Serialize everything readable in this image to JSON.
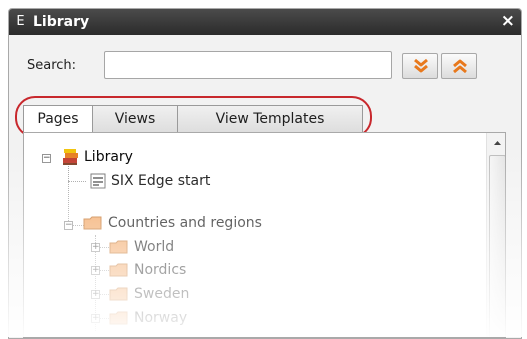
{
  "window": {
    "badge": "E",
    "title": "Library",
    "close_glyph": "×"
  },
  "search": {
    "label": "Search:",
    "value": "",
    "placeholder": ""
  },
  "nav": {
    "down_icon": "double-chevron-down-icon",
    "up_icon": "double-chevron-up-icon"
  },
  "tabs": [
    {
      "label": "Pages",
      "active": true
    },
    {
      "label": "Views",
      "active": false
    },
    {
      "label": "View Templates",
      "active": false
    }
  ],
  "tree": {
    "root": {
      "label": "Library",
      "icon": "library-books-icon",
      "expanded": true
    },
    "items": [
      {
        "label": "SIX Edge start",
        "icon": "page-icon"
      },
      {
        "label": "Countries and regions",
        "icon": "folder-icon",
        "expanded": true,
        "children": [
          {
            "label": "World",
            "icon": "folder-icon"
          },
          {
            "label": "Nordics",
            "icon": "folder-icon"
          },
          {
            "label": "Sweden",
            "icon": "folder-icon"
          },
          {
            "label": "Norway",
            "icon": "folder-icon"
          }
        ]
      }
    ]
  },
  "colors": {
    "title_bar": "#3a3a3a",
    "accent_orange": "#e8791d",
    "highlight": "#c8282d",
    "folder": "#f2a15a"
  }
}
